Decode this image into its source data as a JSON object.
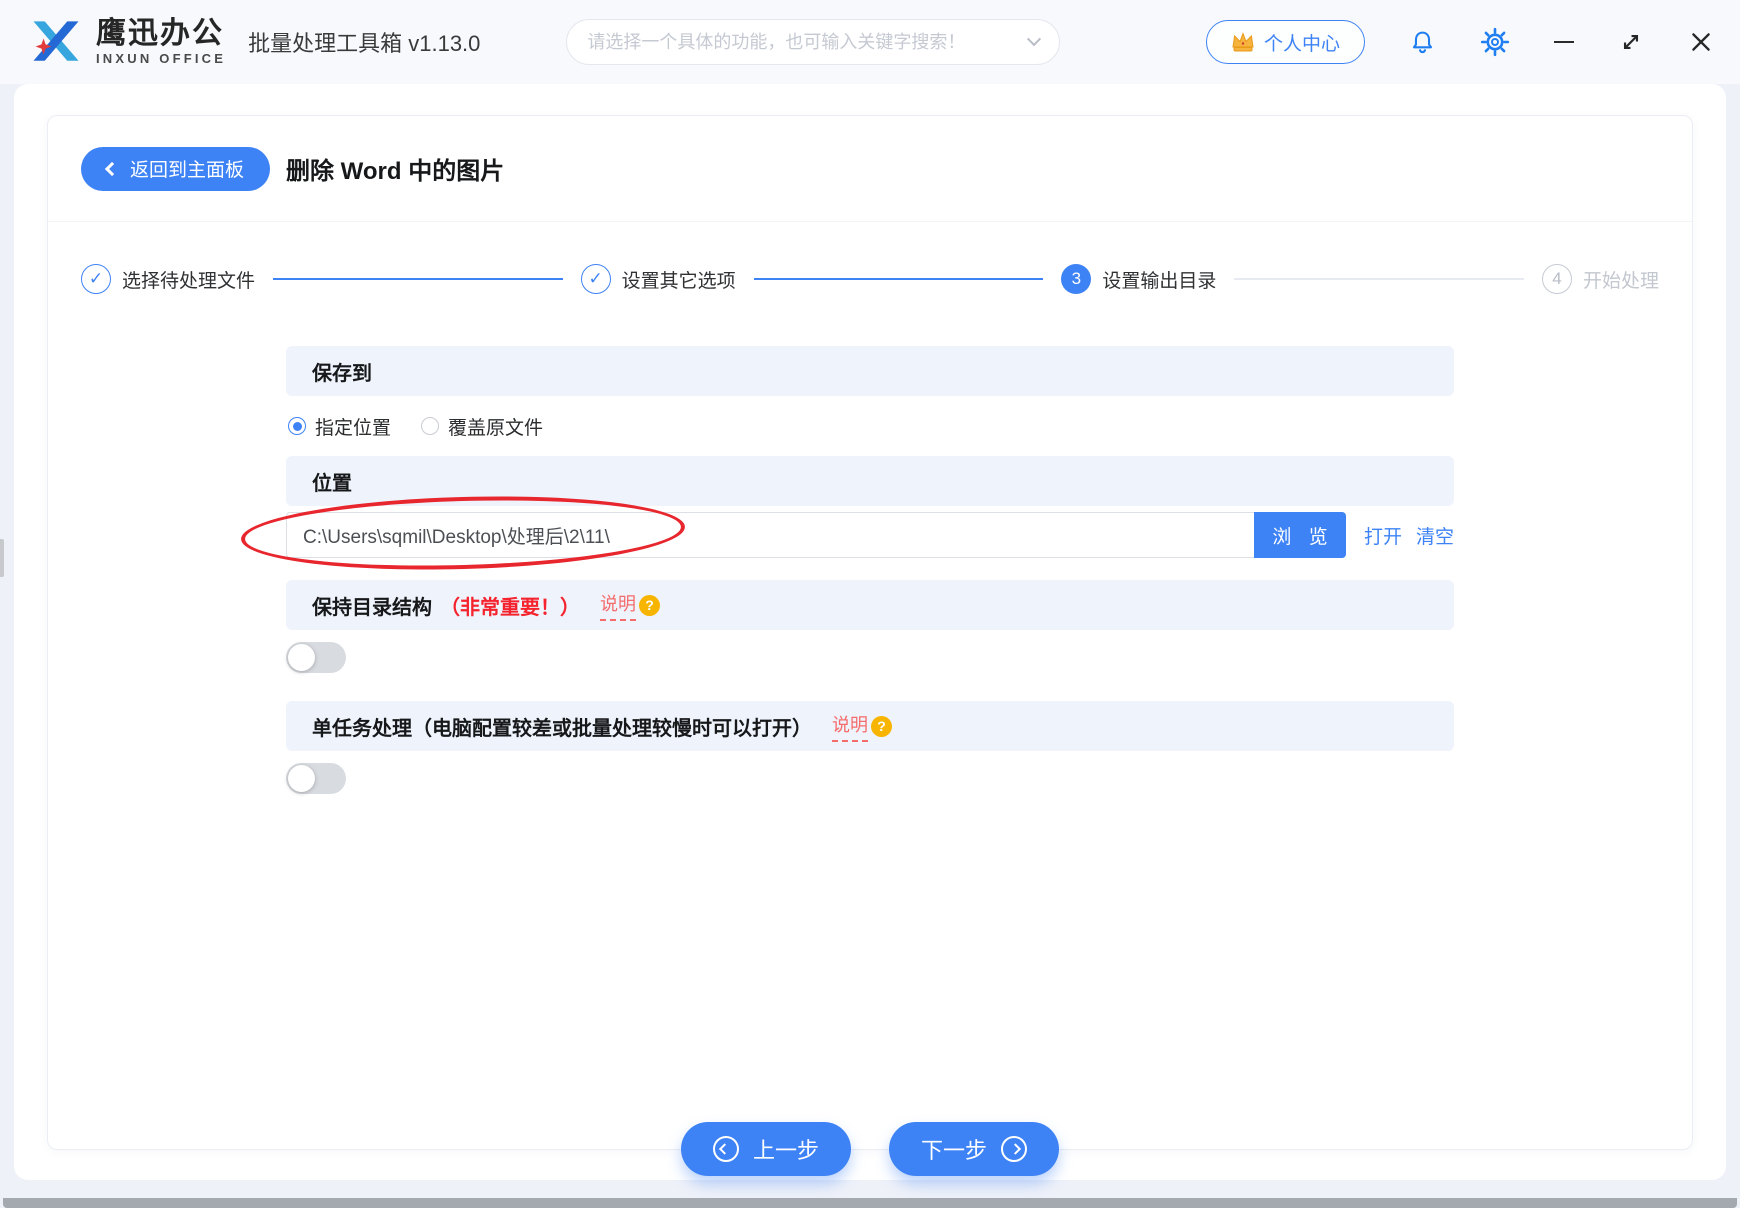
{
  "app": {
    "brand_cn": "鹰迅办公",
    "brand_en": "INXUN OFFICE",
    "title": "批量处理工具箱 v1.13.0",
    "search_placeholder": "请选择一个具体的功能，也可输入关键字搜索！",
    "user_center": "个人中心"
  },
  "header": {
    "back_label": "返回到主面板",
    "page_title": "删除 Word 中的图片"
  },
  "steps": [
    {
      "label": "选择待处理文件",
      "state": "done"
    },
    {
      "label": "设置其它选项",
      "state": "done"
    },
    {
      "label": "设置输出目录",
      "state": "current",
      "number": "3"
    },
    {
      "label": "开始处理",
      "state": "pending",
      "number": "4"
    }
  ],
  "save_to": {
    "section_title": "保存到",
    "options": [
      {
        "label": "指定位置",
        "selected": true
      },
      {
        "label": "覆盖原文件",
        "selected": false
      }
    ]
  },
  "location": {
    "section_title": "位置",
    "path_value": "C:\\Users\\sqmil\\Desktop\\处理后\\2\\11\\",
    "browse_label": "浏 览",
    "open_label": "打开",
    "clear_label": "清空"
  },
  "keep_structure": {
    "title": "保持目录结构",
    "important": "（非常重要！）",
    "help_label": "说明",
    "toggle_state": "off"
  },
  "single_task": {
    "title": "单任务处理（电脑配置较差或批量处理较慢时可以打开）",
    "help_label": "说明",
    "toggle_state": "off"
  },
  "footer": {
    "prev_label": "上一步",
    "next_label": "下一步"
  },
  "icons": {
    "check": "✓",
    "question": "?"
  },
  "colors": {
    "primary": "#3e83f5",
    "annotation_red": "#e8262d",
    "warning_red": "#f5232d",
    "help_orange": "#f7b500",
    "banner_bg": "#eff3fc"
  }
}
